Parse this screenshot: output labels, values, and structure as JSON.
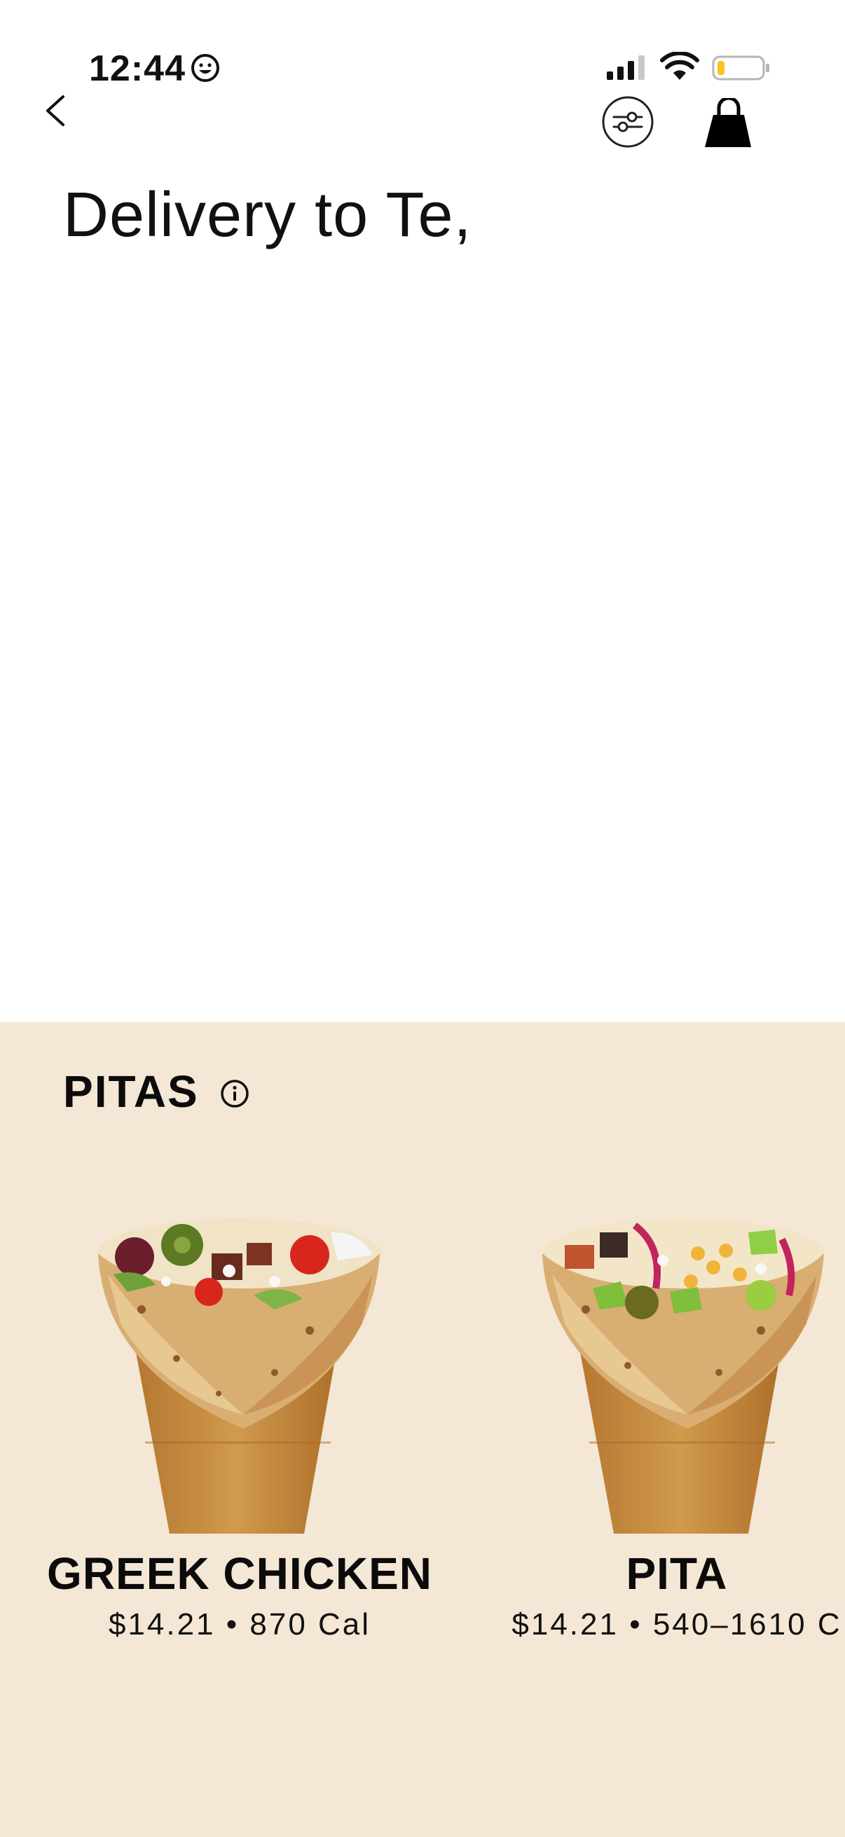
{
  "status_bar": {
    "time": "12:44",
    "icons": [
      "smiley-face-icon",
      "cellular-signal-icon",
      "wifi-icon",
      "battery-icon"
    ],
    "battery_color": "#f5c518"
  },
  "nav": {
    "back_icon": "chevron-left-icon",
    "filter_icon": "sliders-icon",
    "bag_icon": "shopping-bag-icon"
  },
  "header": {
    "title": "Delivery to Te,"
  },
  "menu": {
    "background_color": "#f4e7d5",
    "section_title": "PITAS",
    "section_info_icon": "info-icon",
    "items": [
      {
        "name": "GREEK CHICKEN",
        "meta": "$14.21 • 870 Cal",
        "image_icon": "greek-chicken-pita-image"
      },
      {
        "name": "PITA",
        "meta": "$14.21 • 540–1610 C",
        "image_icon": "pita-image"
      }
    ]
  }
}
